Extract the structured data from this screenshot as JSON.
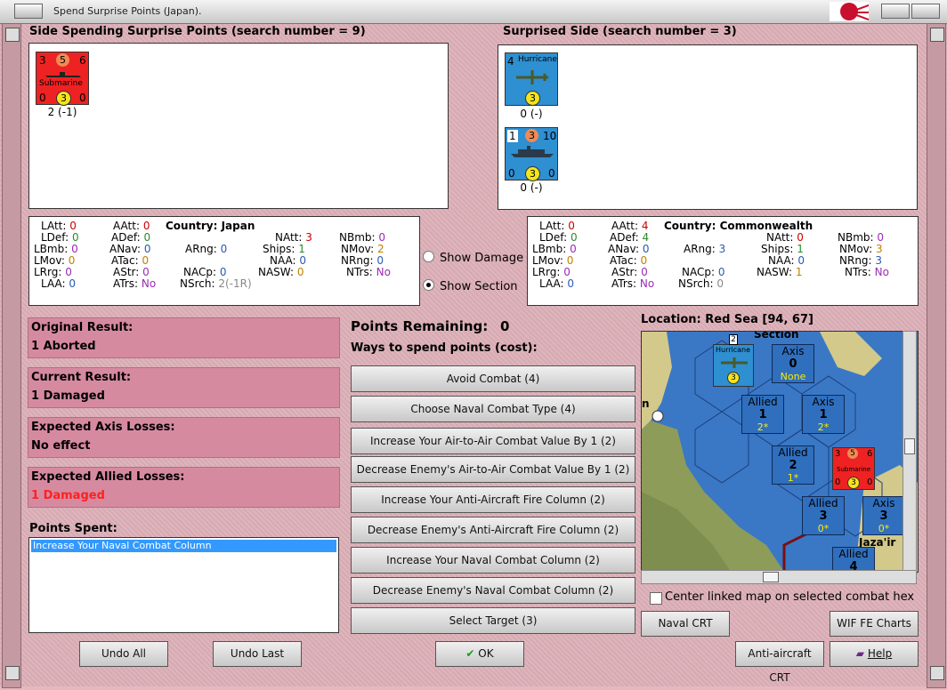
{
  "window": {
    "title": "Spend Surprise Points (Japan)."
  },
  "left": {
    "header": "Side Spending Surprise Points (search number = 9)",
    "unit": {
      "name": "Submarine",
      "top": [
        "3",
        "5",
        "6"
      ],
      "bottom": [
        "0",
        "3",
        "0"
      ],
      "caption": "2 (-1)"
    },
    "stats": {
      "country": "Country: Japan",
      "rows": [
        {
          "k": "LAtt:",
          "v": "0"
        },
        {
          "k": "LDef:",
          "v": "0"
        },
        {
          "k": "LBmb:",
          "v": "0"
        },
        {
          "k": "LMov:",
          "v": "0"
        },
        {
          "k": "LRrg:",
          "v": "0"
        },
        {
          "k": "LAA:",
          "v": "0"
        },
        {
          "k": "AAtt:",
          "v": "0"
        },
        {
          "k": "ADef:",
          "v": "0"
        },
        {
          "k": "ANav:",
          "v": "0"
        },
        {
          "k": "ATac:",
          "v": "0"
        },
        {
          "k": "AStr:",
          "v": "0"
        },
        {
          "k": "ATrs:",
          "v": "No"
        },
        {
          "k": "ARng:",
          "v": "0"
        },
        {
          "k": "NACp:",
          "v": "0"
        },
        {
          "k": "NSrch:",
          "v": "2(-1R)"
        },
        {
          "k": "NAtt:",
          "v": "3"
        },
        {
          "k": "Ships:",
          "v": "1"
        },
        {
          "k": "NAA:",
          "v": "0"
        },
        {
          "k": "NASW:",
          "v": "0"
        },
        {
          "k": "NBmb:",
          "v": "0"
        },
        {
          "k": "NMov:",
          "v": "2"
        },
        {
          "k": "NRng:",
          "v": "0"
        },
        {
          "k": "NTrs:",
          "v": "No"
        }
      ]
    }
  },
  "right": {
    "header": "Surprised Side (search number = 3)",
    "units": [
      {
        "name": "Hurricane",
        "top": [
          "4"
        ],
        "bottom": [
          "3"
        ],
        "caption": "0 (-)"
      },
      {
        "name": "Ships",
        "top": [
          "1",
          "3",
          "10"
        ],
        "bottom": [
          "0",
          "3",
          "0"
        ],
        "caption": "0 (-)"
      }
    ],
    "stats": {
      "country": "Country: Commonwealth",
      "rows": [
        {
          "k": "LAtt:",
          "v": "0"
        },
        {
          "k": "LDef:",
          "v": "0"
        },
        {
          "k": "LBmb:",
          "v": "0"
        },
        {
          "k": "LMov:",
          "v": "0"
        },
        {
          "k": "LRrg:",
          "v": "0"
        },
        {
          "k": "LAA:",
          "v": "0"
        },
        {
          "k": "AAtt:",
          "v": "4"
        },
        {
          "k": "ADef:",
          "v": "4"
        },
        {
          "k": "ANav:",
          "v": "0"
        },
        {
          "k": "ATac:",
          "v": "0"
        },
        {
          "k": "AStr:",
          "v": "0"
        },
        {
          "k": "ATrs:",
          "v": "No"
        },
        {
          "k": "ARng:",
          "v": "3"
        },
        {
          "k": "NACp:",
          "v": "0"
        },
        {
          "k": "NSrch:",
          "v": "0"
        },
        {
          "k": "NAtt:",
          "v": "0"
        },
        {
          "k": "Ships:",
          "v": "1"
        },
        {
          "k": "NAA:",
          "v": "0"
        },
        {
          "k": "NASW:",
          "v": "1"
        },
        {
          "k": "NBmb:",
          "v": "0"
        },
        {
          "k": "NMov:",
          "v": "3"
        },
        {
          "k": "NRng:",
          "v": "3"
        },
        {
          "k": "NTrs:",
          "v": "No"
        }
      ]
    }
  },
  "options": {
    "show_damage": "Show Damage",
    "show_section": "Show Section",
    "selected": "Show Section"
  },
  "results": {
    "original": {
      "label": "Original Result:",
      "value": "1 Aborted"
    },
    "current": {
      "label": "Current Result:",
      "value": "1 Damaged"
    },
    "axis_losses": {
      "label": "Expected Axis Losses:",
      "value": "No effect"
    },
    "allied_losses": {
      "label": "Expected Allied Losses:",
      "value": "1 Damaged"
    }
  },
  "points_spent": {
    "label": "Points Spent:",
    "items": [
      "Increase Your Naval Combat Column"
    ]
  },
  "points_remaining": {
    "label": "Points Remaining:",
    "value": "0"
  },
  "ways_label": "Ways to spend points (cost):",
  "ways": [
    "Avoid Combat (4)",
    "Choose Naval Combat Type (4)",
    "Increase Your Air-to-Air Combat Value By 1 (2)",
    "Decrease Enemy's Air-to-Air Combat Value By 1 (2)",
    "Increase Your Anti-Aircraft Fire Column (2)",
    "Decrease Enemy's Anti-Aircraft Fire Column (2)",
    "Increase Your Naval Combat Column (2)",
    "Decrease Enemy's Naval Combat Column (2)",
    "Select Target (3)"
  ],
  "map": {
    "location": "Location: Red Sea [94, 67]",
    "cells": [
      {
        "side": "Axis",
        "num": "0",
        "sub": "None"
      },
      {
        "side": "Allied",
        "num": "1",
        "sub": "2*"
      },
      {
        "side": "Axis",
        "num": "1",
        "sub": "2*"
      },
      {
        "side": "Allied",
        "num": "2",
        "sub": "1*"
      },
      {
        "side": "Allied",
        "num": "3",
        "sub": "0*"
      },
      {
        "side": "Axis",
        "num": "3",
        "sub": "0*"
      },
      {
        "side": "Allied",
        "num": "4",
        "sub": ""
      }
    ],
    "place_label": "Jaza'ir",
    "top_label": "Section",
    "hurricane_name": "Hurricane",
    "sub_name": "Submarine",
    "center_option": "Center linked map on selected combat hex"
  },
  "buttons": {
    "undo_all": "Undo All",
    "undo_last": "Undo Last",
    "ok": "OK",
    "naval_crt": "Naval CRT",
    "wif_fe_charts": "WIF FE Charts",
    "anti_aircraft_crt": "Anti-aircraft CRT",
    "help": "Help"
  },
  "colors": {
    "axis_red": "#ee2222",
    "allied_blue": "#2e8fd1",
    "result_pink": "#d68aa0",
    "loss_red": "#ff2020"
  }
}
